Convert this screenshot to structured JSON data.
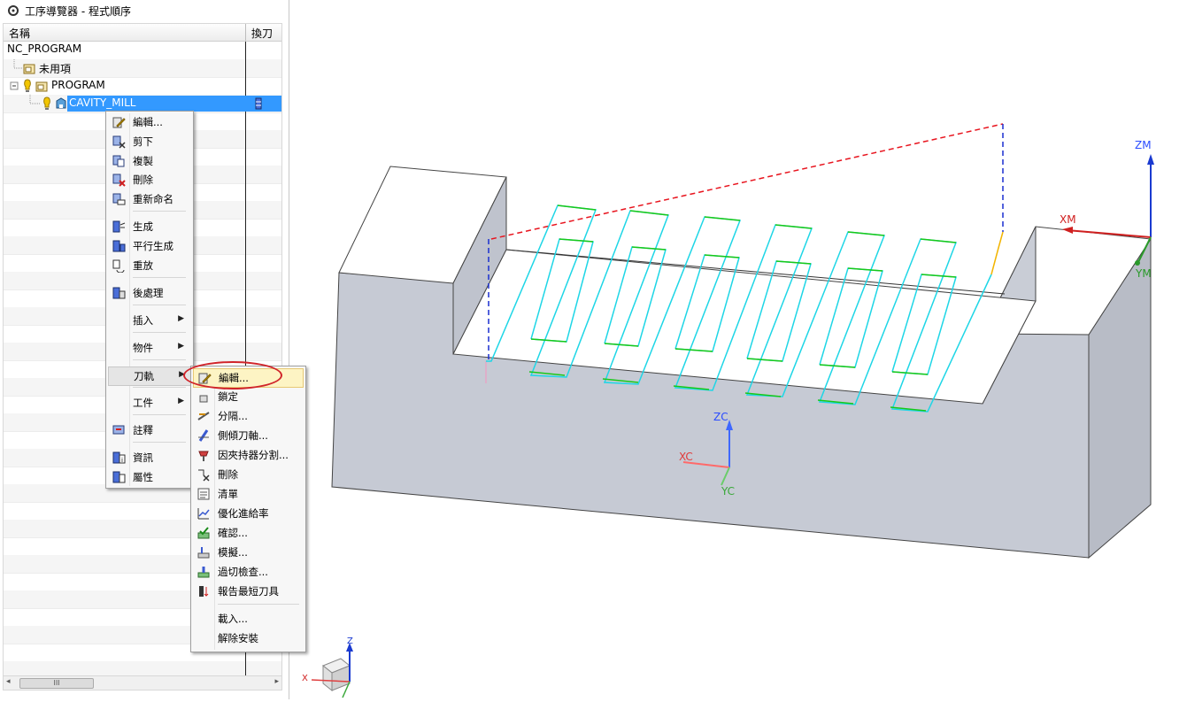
{
  "window": {
    "title": "工序導覽器 - 程式順序"
  },
  "tree": {
    "columns": {
      "name": "名稱",
      "tool_change": "換刀"
    },
    "rows": [
      {
        "label": "NC_PROGRAM"
      },
      {
        "label": "未用項"
      },
      {
        "label": "PROGRAM"
      },
      {
        "label": "CAVITY_MILL"
      }
    ],
    "scroll_thumb": "III"
  },
  "context_menu": {
    "items": [
      {
        "label": "編輯..."
      },
      {
        "label": "剪下"
      },
      {
        "label": "複製"
      },
      {
        "label": "刪除"
      },
      {
        "label": "重新命名"
      },
      {
        "label": "生成"
      },
      {
        "label": "平行生成"
      },
      {
        "label": "重放"
      },
      {
        "label": "後處理"
      },
      {
        "label": "插入"
      },
      {
        "label": "物件"
      },
      {
        "label": "刀軌"
      },
      {
        "label": "工件"
      },
      {
        "label": "註釋"
      },
      {
        "label": "資訊"
      },
      {
        "label": "屬性"
      }
    ]
  },
  "submenu": {
    "items": [
      {
        "label": "編輯..."
      },
      {
        "label": "鎖定"
      },
      {
        "label": "分隔..."
      },
      {
        "label": "側傾刀軸..."
      },
      {
        "label": "因夾持器分割..."
      },
      {
        "label": "刪除"
      },
      {
        "label": "清單"
      },
      {
        "label": "優化進給率"
      },
      {
        "label": "確認..."
      },
      {
        "label": "模擬..."
      },
      {
        "label": "過切檢查..."
      },
      {
        "label": "報告最短刀具"
      },
      {
        "label": "載入..."
      },
      {
        "label": "解除安裝"
      }
    ]
  },
  "viewport": {
    "wcs_labels": {
      "x": "XC",
      "y": "YC",
      "z": "ZC"
    },
    "mcs_labels": {
      "x": "XM",
      "y": "YM",
      "z": "ZM"
    },
    "triad_labels": {
      "x": "X",
      "z": "Z"
    }
  },
  "colors": {
    "selection": "#3399ff",
    "toolpath_cut": "#1ed6e6",
    "toolpath_engage": "#18c818",
    "rapid": "#e8141e",
    "highlight_circle": "#d0242a",
    "part_top": "#ffffff",
    "part_side": "#c8ccd6"
  }
}
